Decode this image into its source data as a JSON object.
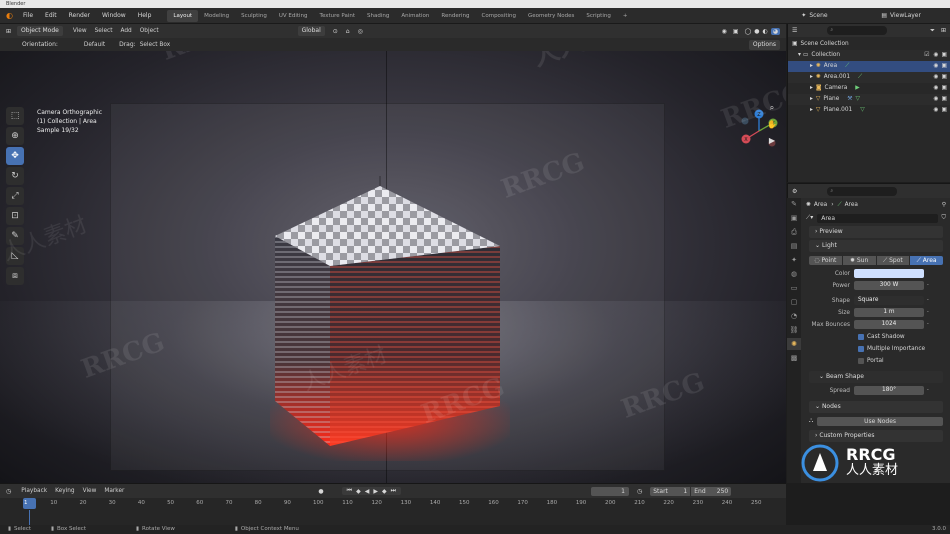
{
  "window": {
    "title": "Blender"
  },
  "menu": {
    "items": [
      "File",
      "Edit",
      "Render",
      "Window",
      "Help"
    ],
    "workspace_tabs": [
      "Layout",
      "Modeling",
      "Sculpting",
      "UV Editing",
      "Texture Paint",
      "Shading",
      "Animation",
      "Rendering",
      "Compositing",
      "Geometry Nodes",
      "Scripting"
    ],
    "active_tab": "Layout",
    "add_tab": "+",
    "scene_label": "Scene",
    "viewlayer_label": "ViewLayer"
  },
  "viewport_header": {
    "mode": "Object Mode",
    "menus": [
      "View",
      "Select",
      "Add",
      "Object"
    ],
    "transform_orientation": "Global",
    "orientation_label": "Orientation:",
    "orientation_value": "Default",
    "drag_label": "Drag:",
    "drag_value": "Select Box",
    "options": "Options"
  },
  "viewport_overlay": {
    "line1": "Camera Orthographic",
    "line2": "(1) Collection | Area",
    "line3": "Sample 19/32"
  },
  "gizmo": {
    "x": "X",
    "y": "Y",
    "z": "Z"
  },
  "outliner": {
    "search_placeholder": "",
    "root": "Scene Collection",
    "collection": "Collection",
    "items": [
      {
        "name": "Area",
        "selected": true
      },
      {
        "name": "Area.001",
        "selected": false
      },
      {
        "name": "Camera",
        "selected": false
      },
      {
        "name": "Plane",
        "selected": false
      },
      {
        "name": "Plane.001",
        "selected": false
      }
    ]
  },
  "properties": {
    "breadcrumb_obj": "Area",
    "breadcrumb_data": "Area",
    "data_name": "Area",
    "preview": "Preview",
    "light": "Light",
    "light_types": [
      "Point",
      "Sun",
      "Spot",
      "Area"
    ],
    "active_light_type": "Area",
    "fields": {
      "color_label": "Color",
      "power_label": "Power",
      "power_value": "300 W",
      "shape_label": "Shape",
      "shape_value": "Square",
      "size_label": "Size",
      "size_value": "1 m",
      "bounces_label": "Max Bounces",
      "bounces_value": "1024"
    },
    "checkboxes": [
      {
        "label": "Cast Shadow",
        "checked": true
      },
      {
        "label": "Multiple Importance",
        "checked": true
      },
      {
        "label": "Portal",
        "checked": false
      }
    ],
    "beam_shape": "Beam Shape",
    "spread_label": "Spread",
    "spread_value": "180°",
    "nodes": "Nodes",
    "use_nodes": "Use Nodes",
    "custom_properties": "Custom Properties",
    "light_color": "#cfe0ff"
  },
  "timeline": {
    "menus": [
      "Playback",
      "Keying",
      "View",
      "Marker"
    ],
    "current_frame": "1",
    "start_label": "Start",
    "start_value": "1",
    "end_label": "End",
    "end_value": "250",
    "ticks": [
      "1",
      "10",
      "20",
      "30",
      "40",
      "50",
      "60",
      "70",
      "80",
      "90",
      "100",
      "110",
      "120",
      "130",
      "140",
      "150",
      "160",
      "170",
      "180",
      "190",
      "200",
      "210",
      "220",
      "230",
      "240",
      "250"
    ]
  },
  "status_bar": {
    "select": "Select",
    "box_select": "Box Select",
    "rotate_view": "Rotate View",
    "context_menu": "Object Context Menu",
    "version": "3.0.0"
  },
  "watermark": {
    "latin": "RRCG",
    "chinese": "人人素材",
    "brand_latin": "RRCG",
    "brand_chinese": "人人素材"
  },
  "colors": {
    "accent": "#4772b3",
    "selection": "#334d80",
    "glow": "#ff2a1a",
    "property_active": "#e9b95c"
  }
}
